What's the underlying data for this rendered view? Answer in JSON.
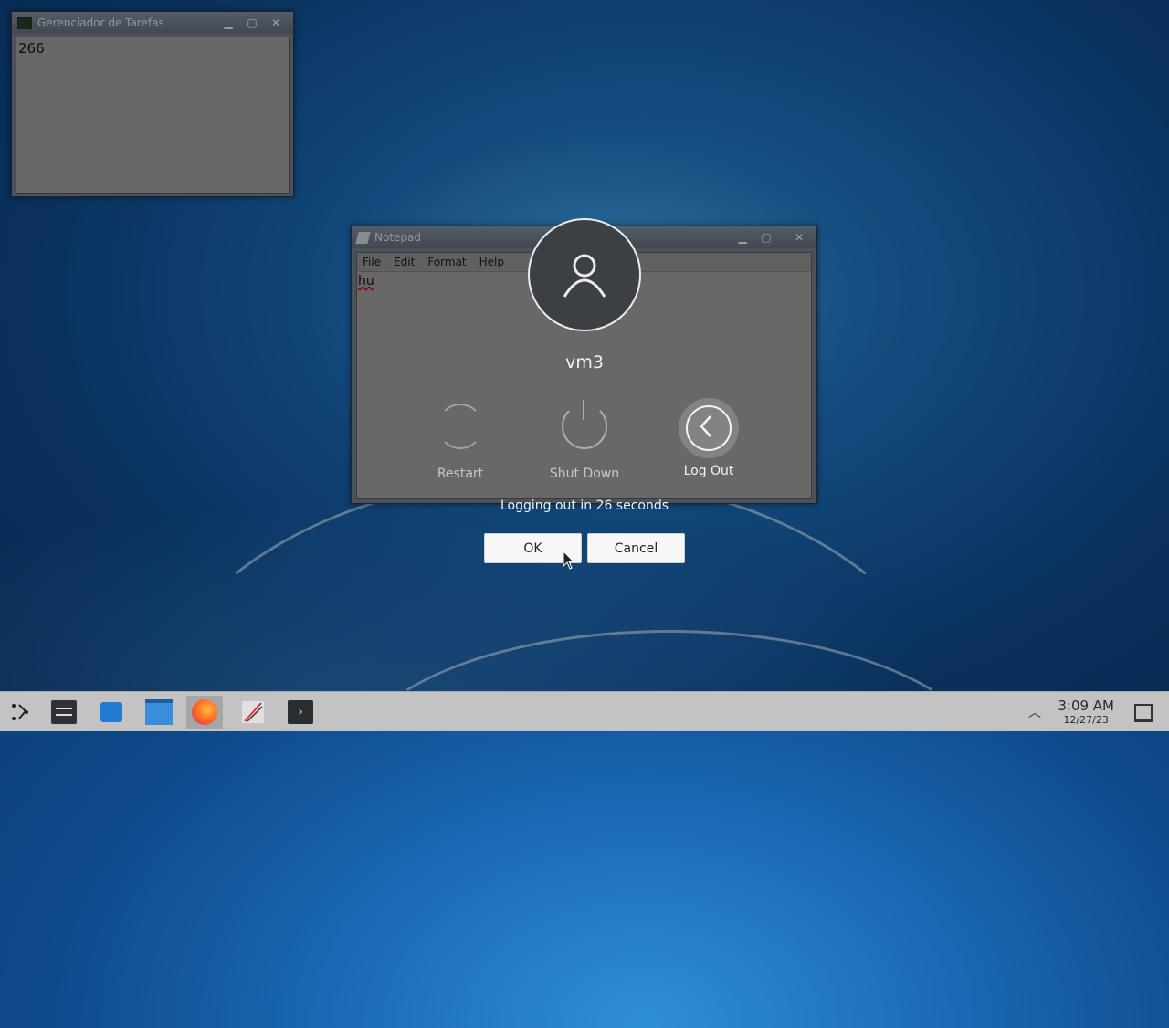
{
  "task_manager": {
    "title": "Gerenciador de Tarefas",
    "content": "266"
  },
  "notepad": {
    "title": "Notepad",
    "menu": [
      "File",
      "Edit",
      "Format",
      "Help"
    ],
    "content": "hu"
  },
  "logout_dialog": {
    "username": "vm3",
    "actions": [
      {
        "label": "Restart",
        "icon": "restart-icon"
      },
      {
        "label": "Shut Down",
        "icon": "power-icon"
      },
      {
        "label": "Log Out",
        "icon": "logout-icon"
      }
    ],
    "countdown": "Logging out in 26 seconds",
    "ok_label": "OK",
    "cancel_label": "Cancel"
  },
  "taskbar": {
    "time": "3:09 AM",
    "date": "12/27/23",
    "apps": [
      "app-launcher-icon",
      "settings-icon",
      "store-icon",
      "files-icon",
      "firefox-icon",
      "editor-icon",
      "terminal-icon"
    ]
  },
  "colors": {
    "wallpaper": "#1a68b3",
    "taskbar": "#c3c3c3"
  }
}
